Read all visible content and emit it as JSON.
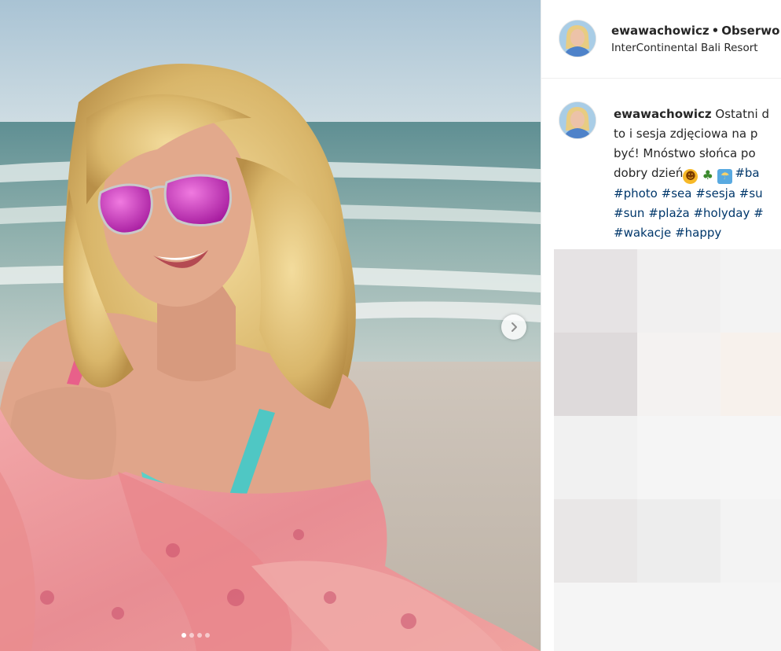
{
  "post": {
    "username": "ewawachowicz",
    "separator": "•",
    "follow_label": "Obserwo",
    "location": "InterContinental Bali Resort"
  },
  "caption": {
    "username": "ewawachowicz",
    "line1": "Ostatni d",
    "line2": "to i sesja zdjęciowa na p",
    "line3": "być! Mnóstwo słońca po",
    "line4_text": "dobry dzień",
    "line4_tag": "#ba",
    "hashtags": [
      "#photo",
      "#sea",
      "#sesja",
      "#su",
      "#sun",
      "#plaża",
      "#holyday",
      "#",
      "#wakacje",
      "#happy"
    ]
  },
  "carousel": {
    "slide_count": 4,
    "active_slide": 1
  },
  "icons": {
    "next": "chevron-right-icon",
    "emojis": [
      "kissing-face-icon",
      "palm-tree-icon",
      "beach-umbrella-icon"
    ]
  },
  "colors": {
    "hashtag": "#00376b",
    "text": "#262626",
    "divider": "#efefef",
    "placeholder_grid": [
      "#e6e3e4",
      "#f1f0f0",
      "#f3f3f3",
      "#dedadb",
      "#f4f2f1",
      "#f7f1ec",
      "#f1f1f1",
      "#f5f5f5",
      "#f6f6f6",
      "#e9e7e7",
      "#ededed",
      "#f3f3f3",
      "#f5f5f5",
      "#f5f5f5",
      "#f5f5f5"
    ]
  }
}
